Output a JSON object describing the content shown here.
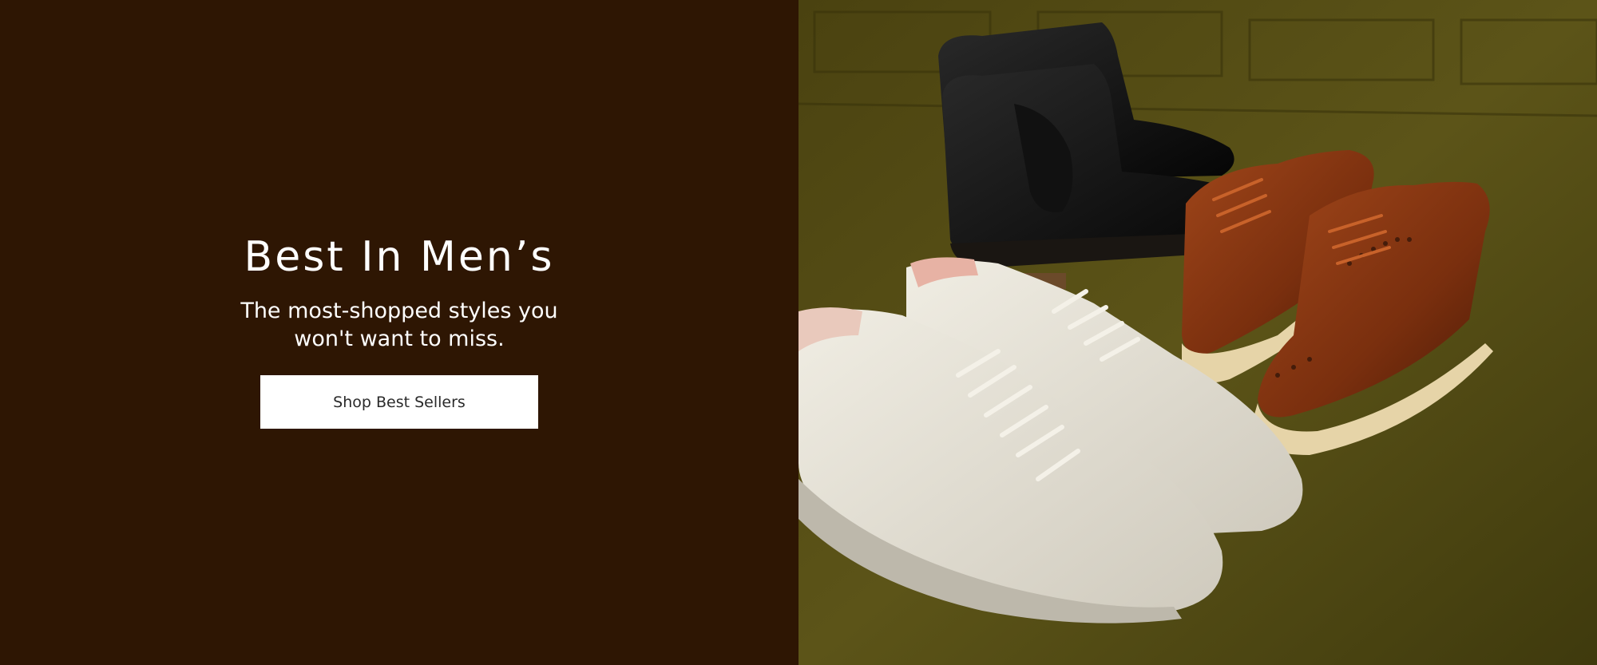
{
  "hero": {
    "title": "Best In Men’s",
    "subtitle": "The most-shopped styles you won't want to miss.",
    "cta_label": "Shop Best Sellers"
  },
  "image": {
    "icon": "product-photo-mens-shoes"
  },
  "colors": {
    "left_background": "#2e1603",
    "button_background": "#ffffff",
    "button_text": "#2a2a2a",
    "carpet": "#524a14"
  }
}
